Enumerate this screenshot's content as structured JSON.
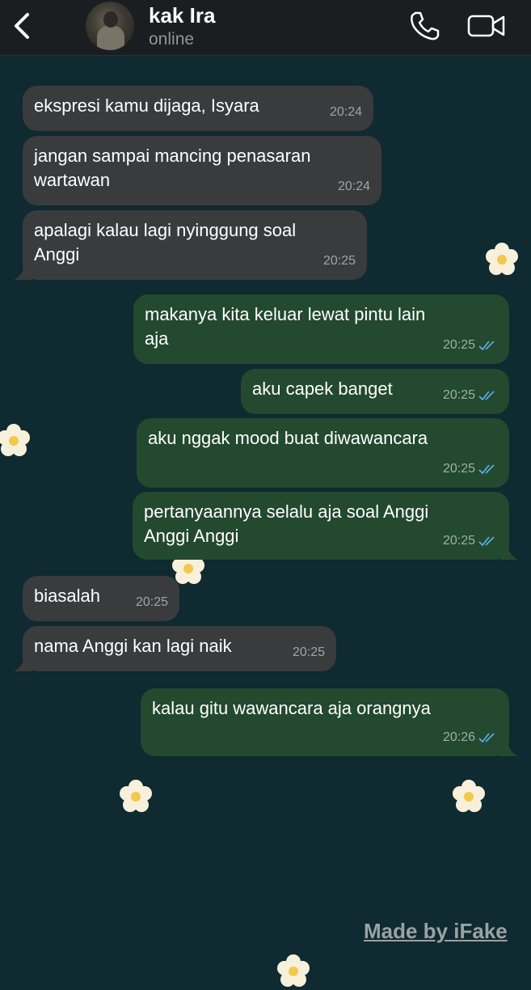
{
  "header": {
    "contact_name": "kak Ira",
    "status": "online"
  },
  "messages": [
    {
      "dir": "in",
      "lines": [
        "ekspresi kamu dijaga, Isyara"
      ],
      "time": "20:24"
    },
    {
      "dir": "in",
      "lines": [
        "jangan sampai mancing penasaran",
        "wartawan"
      ],
      "time": "20:24"
    },
    {
      "dir": "in",
      "lines": [
        "apalagi kalau lagi nyinggung soal",
        "Anggi"
      ],
      "time": "20:25"
    },
    {
      "dir": "out",
      "lines": [
        "makanya kita keluar lewat pintu lain",
        "aja"
      ],
      "time": "20:25",
      "read": true
    },
    {
      "dir": "out",
      "lines": [
        "aku capek banget"
      ],
      "time": "20:25",
      "read": true
    },
    {
      "dir": "out",
      "lines": [
        "aku nggak mood buat diwawancara"
      ],
      "time": "20:25",
      "read": true
    },
    {
      "dir": "out",
      "lines": [
        "pertanyaannya selalu aja soal Anggi",
        "Anggi Anggi"
      ],
      "time": "20:25",
      "read": true
    },
    {
      "dir": "in",
      "lines": [
        "biasalah"
      ],
      "time": "20:25"
    },
    {
      "dir": "in",
      "lines": [
        "nama Anggi kan lagi naik"
      ],
      "time": "20:25"
    },
    {
      "dir": "out",
      "lines": [
        "kalau gitu wawancara aja orangnya"
      ],
      "time": "20:26",
      "read": true
    }
  ],
  "watermark": "Made by iFake",
  "colors": {
    "background": "#0f2a30",
    "incoming_bubble": "#3a3b3d",
    "outgoing_bubble": "#23492f",
    "read_ticks": "#5aa8e6"
  },
  "icons": [
    "back-chevron-icon",
    "phone-icon",
    "video-camera-icon",
    "double-check-icon",
    "flower-icon"
  ]
}
